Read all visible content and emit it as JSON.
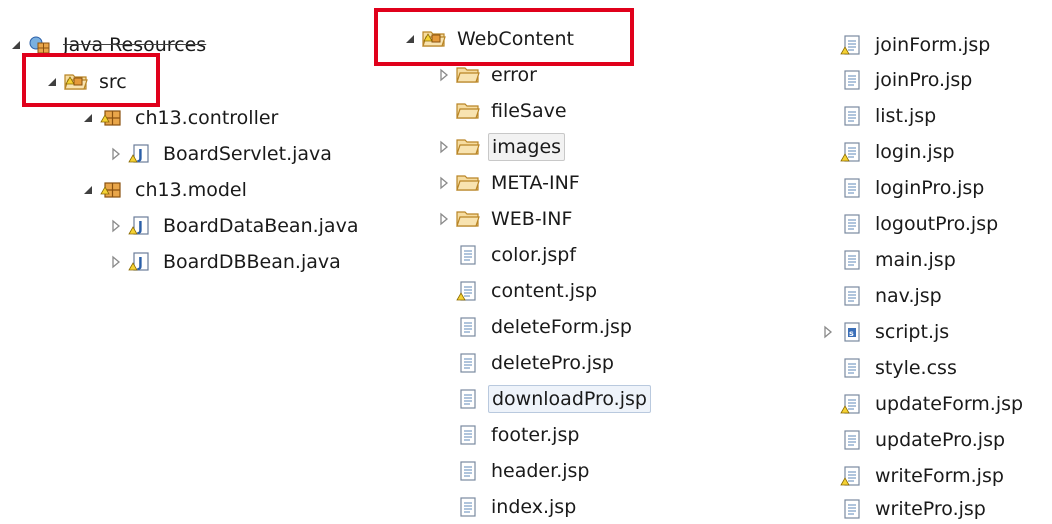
{
  "tree_left": {
    "root": "Java Resources",
    "src": "src",
    "packages": [
      {
        "name": "ch13.controller",
        "files": [
          "BoardServlet.java"
        ]
      },
      {
        "name": "ch13.model",
        "files": [
          "BoardDataBean.java",
          "BoardDBBean.java"
        ]
      }
    ]
  },
  "tree_mid": {
    "root": "WebContent",
    "folders": [
      "error",
      "fileSave",
      "images",
      "META-INF",
      "WEB-INF"
    ],
    "files": [
      "color.jspf",
      "content.jsp",
      "deleteForm.jsp",
      "deletePro.jsp",
      "downloadPro.jsp",
      "footer.jsp",
      "header.jsp",
      "index.jsp"
    ]
  },
  "tree_right": {
    "files": [
      "joinForm.jsp",
      "joinPro.jsp",
      "list.jsp",
      "login.jsp",
      "loginPro.jsp",
      "logoutPro.jsp",
      "main.jsp",
      "nav.jsp",
      "script.js",
      "style.css",
      "updateForm.jsp",
      "updatePro.jsp",
      "writeForm.jsp",
      "writePro.jsp"
    ]
  },
  "colors": {
    "highlight_border": "#e0001b",
    "folder": "#e9b15a",
    "package": "#c47a1c",
    "java_file": "#2b5fa8"
  }
}
